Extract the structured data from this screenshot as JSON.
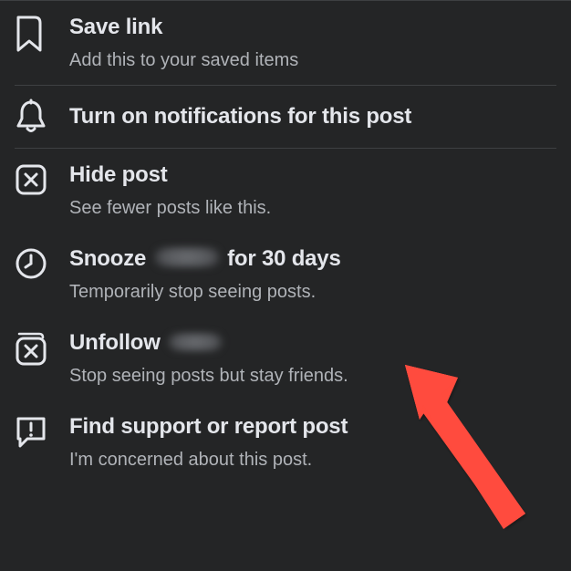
{
  "menu": {
    "save": {
      "title": "Save link",
      "subtitle": "Add this to your saved items"
    },
    "notifications": {
      "title": "Turn on notifications for this post"
    },
    "hide": {
      "title": "Hide post",
      "subtitle": "See fewer posts like this."
    },
    "snooze": {
      "title_prefix": "Snooze",
      "title_suffix": "for 30 days",
      "subtitle": "Temporarily stop seeing posts."
    },
    "unfollow": {
      "title_prefix": "Unfollow",
      "subtitle": "Stop seeing posts but stay friends."
    },
    "report": {
      "title": "Find support or report post",
      "subtitle": "I'm concerned about this post."
    }
  }
}
